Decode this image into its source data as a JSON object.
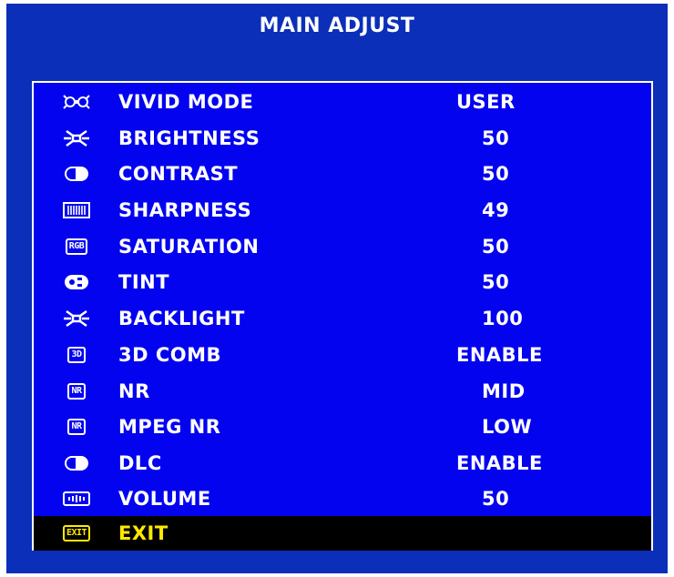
{
  "title": "MAIN ADJUST",
  "colors": {
    "frame": "#0b2fb8",
    "panel": "#0303f0",
    "text": "#ffffff",
    "highlight_bg": "#000000",
    "highlight_text": "#ffe900"
  },
  "items": [
    {
      "icon": "vivid-mode-icon",
      "label": "VIVID MODE",
      "value": "USER"
    },
    {
      "icon": "brightness-icon",
      "label": "BRIGHTNESS",
      "value": "50"
    },
    {
      "icon": "contrast-icon",
      "label": "CONTRAST",
      "value": "50"
    },
    {
      "icon": "sharpness-icon",
      "label": "SHARPNESS",
      "value": "49"
    },
    {
      "icon": "rgb-icon",
      "label": "SATURATION",
      "value": "50",
      "icon_text": "RGB"
    },
    {
      "icon": "tint-icon",
      "label": "TINT",
      "value": "50"
    },
    {
      "icon": "backlight-icon",
      "label": "BACKLIGHT",
      "value": "100"
    },
    {
      "icon": "3d-comb-icon",
      "label": "3D COMB",
      "value": "ENABLE",
      "icon_text": "3D"
    },
    {
      "icon": "nr-icon",
      "label": "NR",
      "value": "MID",
      "icon_text": "NR"
    },
    {
      "icon": "nr-icon",
      "label": "MPEG NR",
      "value": "LOW",
      "icon_text": "NR"
    },
    {
      "icon": "dlc-icon",
      "label": "DLC",
      "value": "ENABLE"
    },
    {
      "icon": "volume-icon",
      "label": "VOLUME",
      "value": "50"
    },
    {
      "icon": "exit-icon",
      "label": "EXIT",
      "value": "",
      "icon_text": "EXIT"
    }
  ]
}
